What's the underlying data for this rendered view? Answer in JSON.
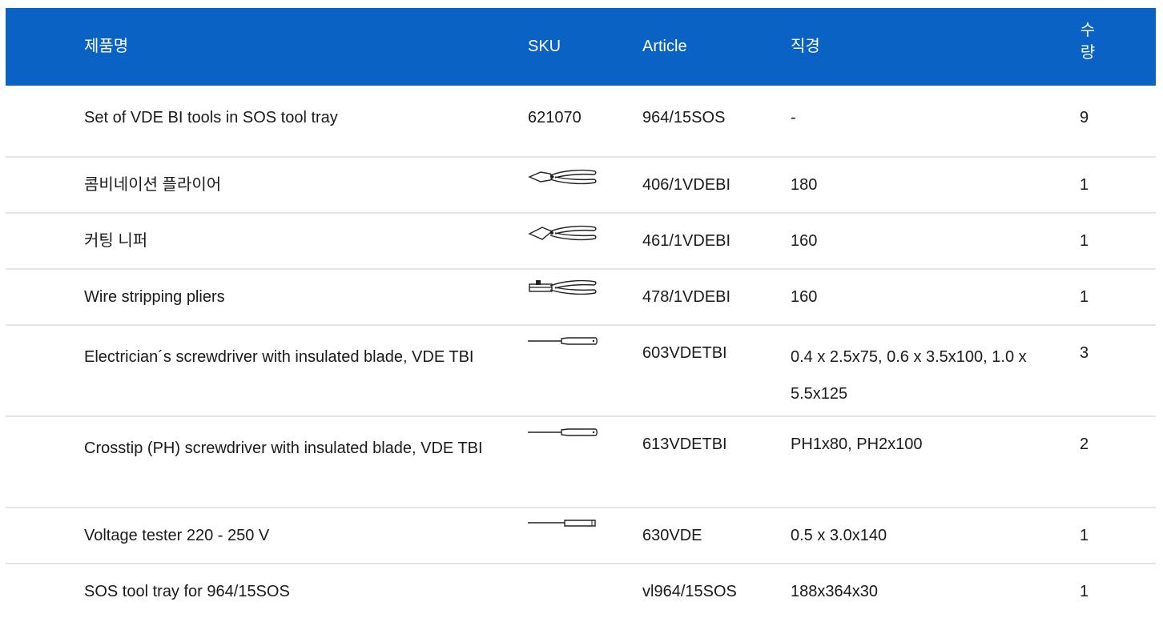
{
  "table": {
    "headers": {
      "name": "제품명",
      "sku": "SKU",
      "article": "Article",
      "diameter": "직경",
      "quantity": "수\n량"
    },
    "rows": [
      {
        "name": "Set of VDE BI tools in SOS tool tray",
        "sku": "621070",
        "article": "964/15SOS",
        "diameter": "-",
        "quantity": "9"
      },
      {
        "name": "콤비네이션 플라이어",
        "sku_icon": "combination-pliers-icon",
        "article": "406/1VDEBI",
        "diameter": "180",
        "quantity": "1"
      },
      {
        "name": "커팅 니퍼",
        "sku_icon": "cutting-nipper-icon",
        "article": "461/1VDEBI",
        "diameter": "160",
        "quantity": "1"
      },
      {
        "name": "Wire stripping pliers",
        "sku_icon": "wire-stripping-pliers-icon",
        "article": "478/1VDEBI",
        "diameter": "160",
        "quantity": "1"
      },
      {
        "name": "Electrician´s screwdriver with insulated blade, VDE TBI",
        "sku_icon": "screwdriver-icon",
        "article": "603VDETBI",
        "diameter": "0.4 x 2.5x75, 0.6 x 3.5x100, 1.0 x 5.5x125",
        "quantity": "3"
      },
      {
        "name": "Crosstip (PH) screwdriver with insulated blade, VDE TBI",
        "sku_icon": "screwdriver-icon",
        "article": "613VDETBI",
        "diameter": "PH1x80, PH2x100",
        "quantity": "2"
      },
      {
        "name": "Voltage tester 220 - 250 V",
        "sku_icon": "voltage-tester-icon",
        "article": "630VDE",
        "diameter": "0.5 x 3.0x140",
        "quantity": "1"
      },
      {
        "name": "SOS tool tray for 964/15SOS",
        "sku": "",
        "article": "vl964/15SOS",
        "diameter": "188x364x30",
        "quantity": "1"
      }
    ]
  }
}
